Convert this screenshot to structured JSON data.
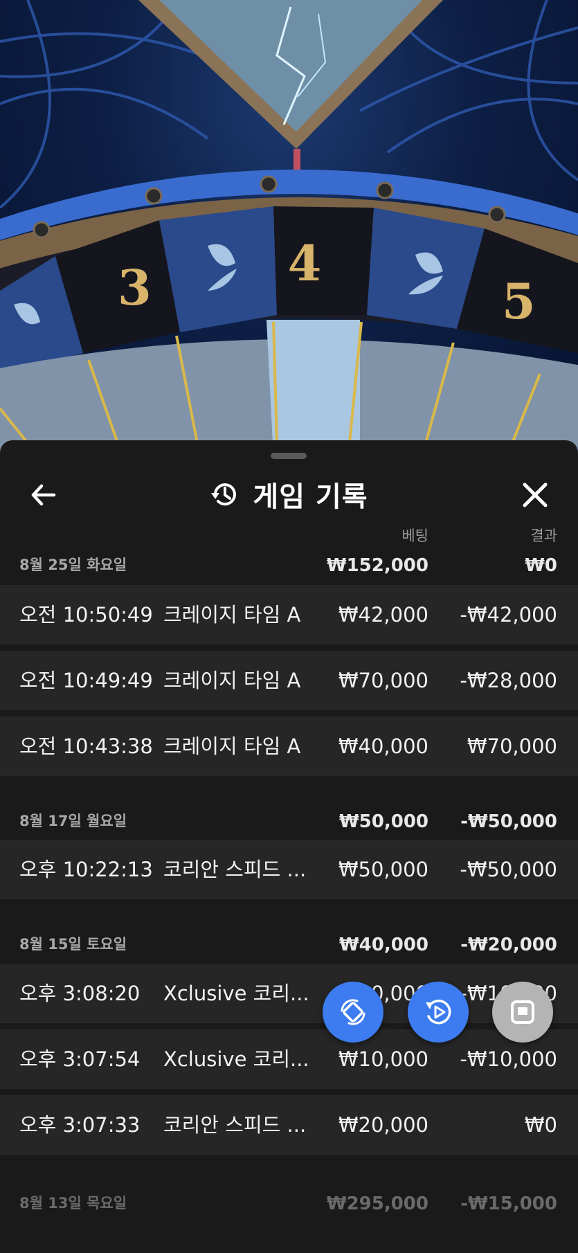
{
  "header": {
    "title": "게임 기록",
    "icons": {
      "back": "arrow-left-icon",
      "history": "history-icon",
      "close": "close-icon"
    }
  },
  "columns": {
    "bet": "베팅",
    "result": "결과"
  },
  "groups": [
    {
      "date": "8월 25일 화요일",
      "bet_total": "₩152,000",
      "result_total": "₩0",
      "rows": [
        {
          "time": "오전 10:50:49",
          "game": "크레이지 타임 A",
          "bet": "₩42,000",
          "result": "-₩42,000"
        },
        {
          "time": "오전 10:49:49",
          "game": "크레이지 타임 A",
          "bet": "₩70,000",
          "result": "-₩28,000"
        },
        {
          "time": "오전 10:43:38",
          "game": "크레이지 타임 A",
          "bet": "₩40,000",
          "result": "₩70,000"
        }
      ]
    },
    {
      "date": "8월 17일 월요일",
      "bet_total": "₩50,000",
      "result_total": "-₩50,000",
      "rows": [
        {
          "time": "오후 10:22:13",
          "game": "코리안 스피드 ...",
          "bet": "₩50,000",
          "result": "-₩50,000"
        }
      ]
    },
    {
      "date": "8월 15일 토요일",
      "bet_total": "₩40,000",
      "result_total": "-₩20,000",
      "rows": [
        {
          "time": "오후 3:08:20",
          "game": "Xclusive 코리...",
          "bet": "₩10,000",
          "result": "-₩10,000"
        },
        {
          "time": "오후 3:07:54",
          "game": "Xclusive 코리...",
          "bet": "₩10,000",
          "result": "-₩10,000"
        },
        {
          "time": "오후 3:07:33",
          "game": "코리안 스피드 ...",
          "bet": "₩20,000",
          "result": "₩0"
        }
      ]
    },
    {
      "date": "8월 13일 목요일",
      "bet_total": "₩295,000",
      "result_total": "-₩15,000",
      "rows": []
    }
  ],
  "wheel": {
    "numbers": [
      "3",
      "4",
      "5"
    ]
  },
  "fabs": [
    {
      "icon": "rotate-device-icon",
      "color": "#3d7bf0"
    },
    {
      "icon": "replay-video-icon",
      "color": "#3d7bf0"
    },
    {
      "icon": "stop-icon",
      "color": "#b4b4b4"
    }
  ]
}
